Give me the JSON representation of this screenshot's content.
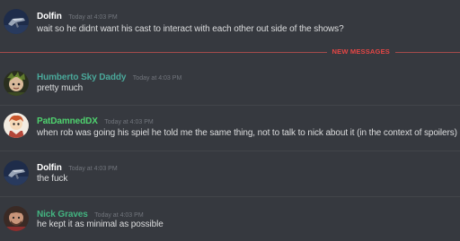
{
  "colors": {
    "background": "#36393f",
    "new_messages": "#e64645",
    "name_white": "#ffffff",
    "name_teal": "#43b581",
    "name_green": "#4fd36f",
    "name_cyan": "#4aa89a"
  },
  "divider": {
    "label": "NEW MESSAGES"
  },
  "messages": [
    {
      "author": "Dolfin",
      "timestamp": "Today at 4:03 PM",
      "text": "wait so he didnt want his cast to interact with each other out side of the shows?",
      "avatar": "dolfin-avatar"
    },
    {
      "author": "Humberto Sky Daddy",
      "timestamp": "Today at 4:03 PM",
      "text": "pretty much",
      "avatar": "humberto-avatar"
    },
    {
      "author": "PatDamnedDX",
      "timestamp": "Today at 4:03 PM",
      "text": "when rob was going his spiel he told me the same thing, not to talk to nick about it (in the context of spoilers)",
      "avatar": "patdamned-avatar"
    },
    {
      "author": "Dolfin",
      "timestamp": "Today at 4:03 PM",
      "text": "the fuck",
      "avatar": "dolfin-avatar"
    },
    {
      "author": "Nick Graves",
      "timestamp": "Today at 4:03 PM",
      "text": "he kept it as minimal as possible",
      "avatar": "nick-avatar"
    }
  ]
}
